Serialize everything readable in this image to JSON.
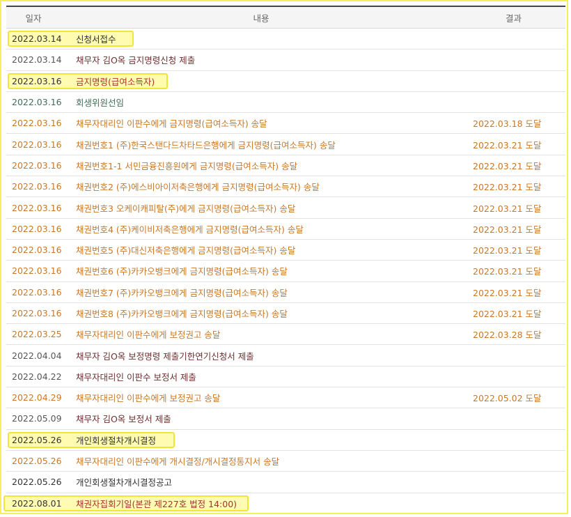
{
  "header": {
    "date": "일자",
    "content": "내용",
    "result": "결과"
  },
  "rows": [
    {
      "date": "2022.03.14",
      "content": "신청서접수",
      "result": ""
    },
    {
      "date": "2022.03.14",
      "content": "채무자 김O옥 금지명령신청 제출",
      "result": ""
    },
    {
      "date": "2022.03.16",
      "content": "금지명령(급여소득자)",
      "result": ""
    },
    {
      "date": "2022.03.16",
      "content": "회생위원선임",
      "result": ""
    },
    {
      "date": "2022.03.16",
      "content": "채무자대리인 이판수에게 금지명령(급여소득자) 송달",
      "result": "2022.03.18 도달"
    },
    {
      "date": "2022.03.16",
      "content": "채권번호1 (주)한국스탠다드차타드은행에게 금지명령(급여소득자) 송달",
      "result": "2022.03.21 도달"
    },
    {
      "date": "2022.03.16",
      "content": "채권번호1-1 서민금융진흥원에게 금지명령(급여소득자) 송달",
      "result": "2022.03.21 도달"
    },
    {
      "date": "2022.03.16",
      "content": "채권번호2 (주)에스비아이저축은행에게 금지명령(급여소득자) 송달",
      "result": "2022.03.21 도달"
    },
    {
      "date": "2022.03.16",
      "content": "채권번호3 오케이캐피탈(주)에게 금지명령(급여소득자) 송달",
      "result": "2022.03.21 도달"
    },
    {
      "date": "2022.03.16",
      "content": "채권번호4 (주)케이비저축은행에게 금지명령(급여소득자) 송달",
      "result": "2022.03.21 도달"
    },
    {
      "date": "2022.03.16",
      "content": "채권번호5 (주)대신저축은행에게 금지명령(급여소득자) 송달",
      "result": "2022.03.21 도달"
    },
    {
      "date": "2022.03.16",
      "content": "채권번호6 (주)카카오뱅크에게 금지명령(급여소득자) 송달",
      "result": "2022.03.21 도달"
    },
    {
      "date": "2022.03.16",
      "content": "채권번호7 (주)카카오뱅크에게 금지명령(급여소득자) 송달",
      "result": "2022.03.21 도달"
    },
    {
      "date": "2022.03.16",
      "content": "채권번호8 (주)카카오뱅크에게 금지명령(급여소득자) 송달",
      "result": "2022.03.21 도달"
    },
    {
      "date": "2022.03.25",
      "content": "채무자대리인 이판수에게 보정권고 송달",
      "result": "2022.03.28 도달"
    },
    {
      "date": "2022.04.04",
      "content": "채무자 김O옥 보정명령 제출기한연기신청서 제출",
      "result": ""
    },
    {
      "date": "2022.04.22",
      "content": "채무자대리인 이판수 보정서 제출",
      "result": ""
    },
    {
      "date": "2022.04.29",
      "content": "채무자대리인 이판수에게 보정권고 송달",
      "result": "2022.05.02 도달"
    },
    {
      "date": "2022.05.09",
      "content": "채무자 김O옥 보정서 제출",
      "result": ""
    },
    {
      "date": "2022.05.26",
      "content": "개인회생절차개시결정",
      "result": ""
    },
    {
      "date": "2022.05.26",
      "content": "채무자대리인 이판수에게 개시결정/개시결정통지서 송달",
      "result": ""
    },
    {
      "date": "2022.05.26",
      "content": "개인회생절차개시결정공고",
      "result": ""
    },
    {
      "date": "2022.08.01",
      "content": "채권자집회기일(본관 제227호 법정 14:00)",
      "result": ""
    }
  ],
  "colors": {
    "frame_border": "#f6ee5a",
    "highlight_fill": "#fffbb0",
    "highlight_border": "#f2e53a",
    "orange_text": "#c8782a",
    "dark_red_text": "#6b2f2f",
    "green_text": "#3e6e55"
  }
}
